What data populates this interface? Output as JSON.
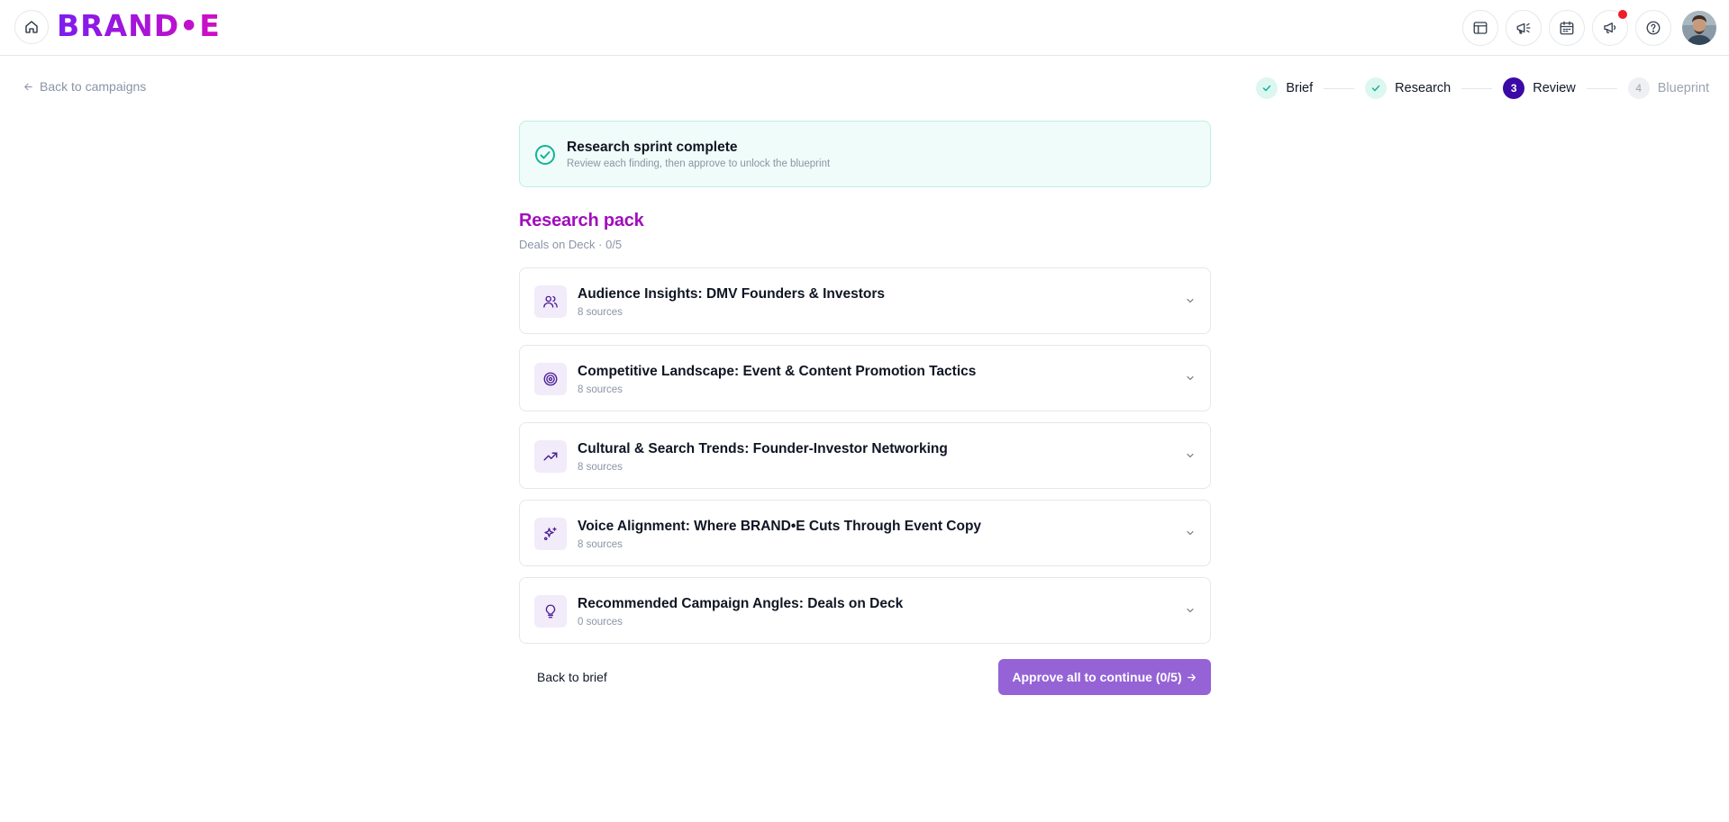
{
  "header": {
    "logo_text": "BRAND•E",
    "icons": [
      "home-icon",
      "layout-icon",
      "megaphone-sparkle-icon",
      "calendar-icon",
      "announcement-icon",
      "help-icon"
    ],
    "notification_color": "#ef1c2c"
  },
  "nav": {
    "back_label": "Back to campaigns"
  },
  "stepper": {
    "steps": [
      {
        "label": "Brief",
        "state": "done",
        "badge": ""
      },
      {
        "label": "Research",
        "state": "done",
        "badge": ""
      },
      {
        "label": "Review",
        "state": "active",
        "badge": "3"
      },
      {
        "label": "Blueprint",
        "state": "pending",
        "badge": "4"
      }
    ]
  },
  "alert": {
    "title": "Research sprint complete",
    "subtitle": "Review each finding, then approve to unlock the blueprint"
  },
  "pack": {
    "title": "Research pack",
    "subtitle": "Deals on Deck · 0/5"
  },
  "findings": [
    {
      "title": "Audience Insights: DMV Founders & Investors",
      "sources": "8 sources",
      "icon": "users-icon"
    },
    {
      "title": "Competitive Landscape: Event & Content Promotion Tactics",
      "sources": "8 sources",
      "icon": "target-icon"
    },
    {
      "title": "Cultural & Search Trends: Founder-Investor Networking",
      "sources": "8 sources",
      "icon": "trending-up-icon"
    },
    {
      "title": "Voice Alignment: Where BRAND•E Cuts Through Event Copy",
      "sources": "8 sources",
      "icon": "sparkles-icon"
    },
    {
      "title": "Recommended Campaign Angles: Deals on Deck",
      "sources": "0 sources",
      "icon": "lightbulb-icon"
    }
  ],
  "actions": {
    "back_label": "Back to brief",
    "approve_label": "Approve all to continue (0/5)"
  },
  "colors": {
    "brand_gradient_start": "#7c1cf0",
    "brand_gradient_end": "#d10ec3",
    "pack_title": "#a10dbd",
    "approve_button": "#9563d6",
    "alert_bg": "#f0fcf9",
    "success": "#14b39a",
    "active_step": "#3b0aa6"
  }
}
